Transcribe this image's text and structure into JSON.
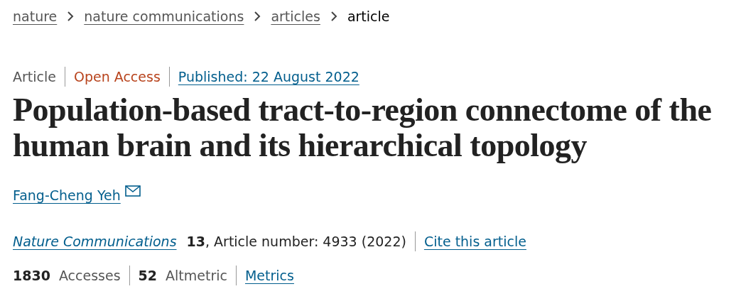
{
  "breadcrumb": [
    {
      "label": "nature",
      "kind": "link"
    },
    {
      "label": "nature communications",
      "kind": "link"
    },
    {
      "label": "articles",
      "kind": "link"
    },
    {
      "label": "article",
      "kind": "current"
    }
  ],
  "article_info": {
    "type": "Article",
    "access": "Open Access",
    "published": "Published: 22 August 2022"
  },
  "title": "Population-based tract-to-region connectome of the human brain and its hierarchical topology",
  "authors": [
    {
      "name": "Fang-Cheng Yeh",
      "contact": true
    }
  ],
  "citation": {
    "journal": "Nature Communications",
    "details": "**13**, Article number: 4933 (2022)",
    "cite": "Cite this article"
  },
  "metrics": [
    "**1830** Accesses",
    "**52** Altmetric"
  ],
  "metrics_link": "Metrics"
}
